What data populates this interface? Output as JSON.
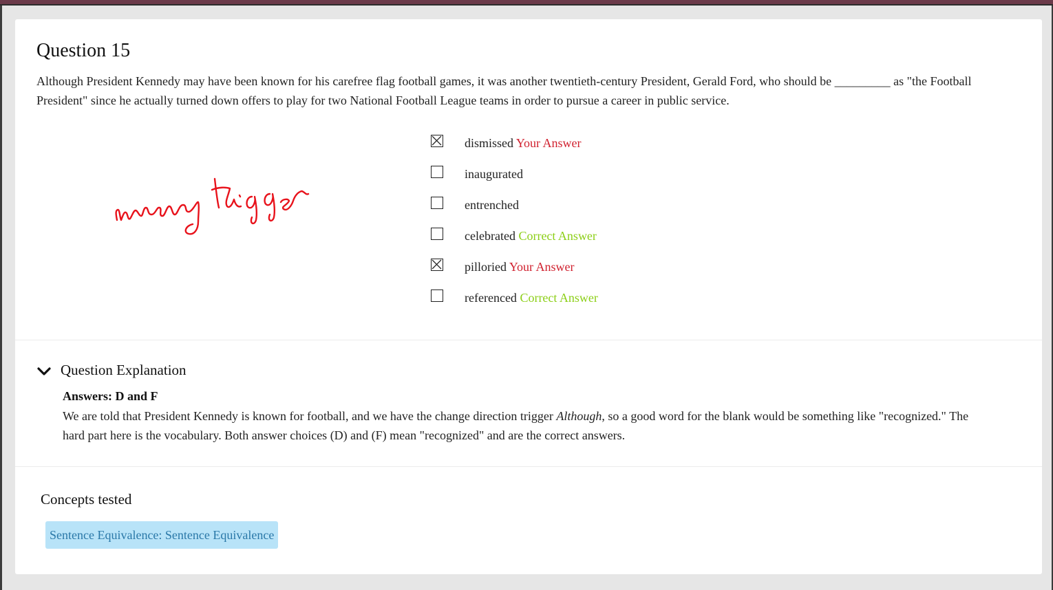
{
  "question": {
    "title": "Question 15",
    "text": "Although President Kennedy may have been known for his carefree flag football games, it was another twentieth-century President, Gerald Ford, who should be _________ as \"the Football President\" since he actually turned down offers to play for two National Football League teams in order to pursue a career in public service."
  },
  "annotation": {
    "text": "wrong trigger",
    "color": "#e8121b"
  },
  "options": [
    {
      "label": "dismissed",
      "checked": true,
      "tag": "Your Answer",
      "tag_type": "wrong"
    },
    {
      "label": "inaugurated",
      "checked": false,
      "tag": "",
      "tag_type": ""
    },
    {
      "label": "entrenched",
      "checked": false,
      "tag": "",
      "tag_type": ""
    },
    {
      "label": "celebrated",
      "checked": false,
      "tag": "Correct Answer",
      "tag_type": "correct"
    },
    {
      "label": "pilloried",
      "checked": true,
      "tag": "Your Answer",
      "tag_type": "wrong"
    },
    {
      "label": "referenced",
      "checked": false,
      "tag": "Correct Answer",
      "tag_type": "correct"
    }
  ],
  "explanation": {
    "toggle_label": "Question Explanation",
    "answers": "Answers: D and F",
    "text_before": "We are told that President Kennedy is known for football, and we have the change direction trigger ",
    "text_italic": "Although",
    "text_after": ", so a good word for the blank would be something like \"recognized.\" The hard part here is the vocabulary. Both answer choices (D) and (F) mean \"recognized\" and are the correct answers."
  },
  "concepts": {
    "title": "Concepts tested",
    "items": [
      "Sentence Equivalence: Sentence Equivalence"
    ]
  },
  "colors": {
    "your_answer": "#d0202e",
    "correct_answer": "#8ccf17",
    "concept_pill_bg": "#b8e3f8",
    "concept_pill_text": "#2a78a8"
  }
}
